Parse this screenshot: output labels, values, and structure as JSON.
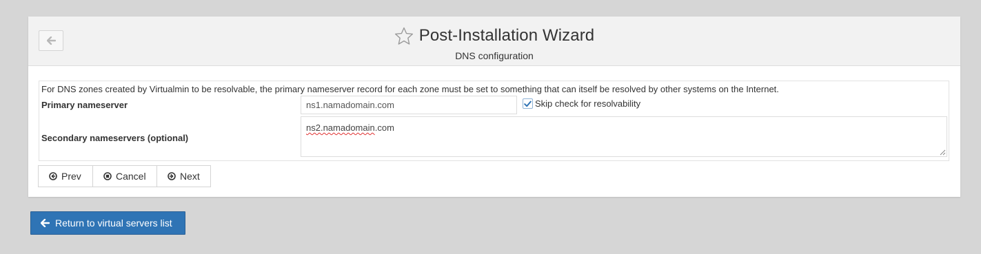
{
  "header": {
    "title": "Post-Installation Wizard",
    "subtitle": "DNS configuration",
    "back_icon": "arrow-left-icon",
    "favorite_icon": "star-outline-icon"
  },
  "form": {
    "description": "For DNS zones created by Virtualmin to be resolvable, the primary nameserver record for each zone must be set to something that can itself be resolved by other systems on the Internet.",
    "primary_label": "Primary nameserver",
    "primary_value": "ns1.namadomain.com",
    "skip_check_label": "Skip check for resolvability",
    "skip_check_checked": true,
    "secondary_label": "Secondary nameservers (optional)",
    "secondary_value_a": "ns2.namadomain",
    "secondary_value_b": ".com"
  },
  "wizard_buttons": {
    "prev": "Prev",
    "cancel": "Cancel",
    "next": "Next"
  },
  "return_button": {
    "label": "Return to virtual servers list"
  },
  "colors": {
    "page_bg": "#d6d6d6",
    "header_bg": "#f2f2f2",
    "primary_button": "#2f74b5",
    "checkbox_check": "#2f74b5"
  }
}
